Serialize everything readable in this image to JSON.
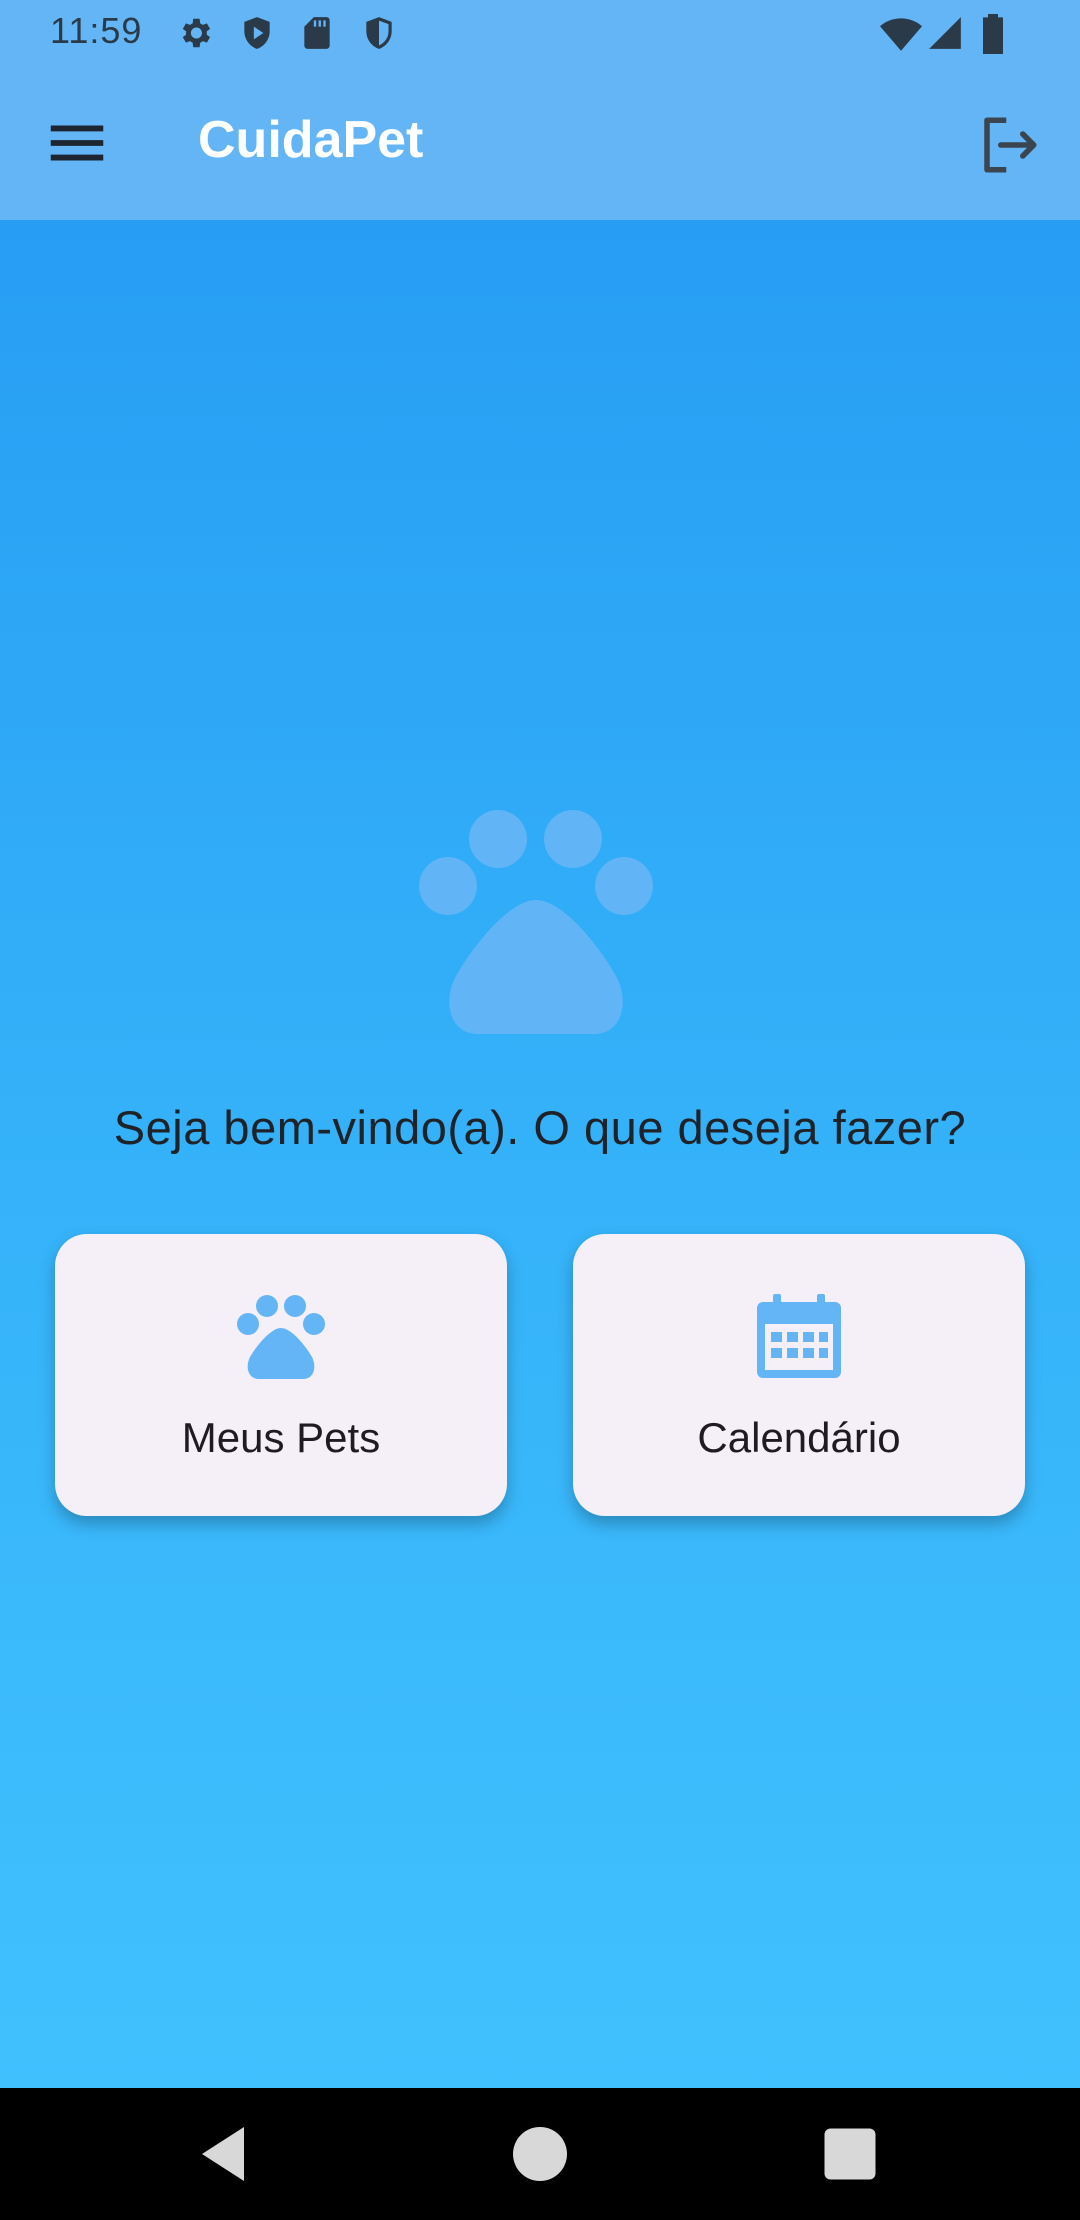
{
  "status_bar": {
    "time": "11:59",
    "icons": [
      "gear-icon",
      "play-shield-icon",
      "sd-card-icon",
      "shield-icon",
      "wifi-icon",
      "signal-icon",
      "battery-icon"
    ]
  },
  "app_bar": {
    "title": "CuidaPet",
    "menu_icon": "menu-icon",
    "logout_icon": "logout-icon"
  },
  "main": {
    "hero_icon": "paw-icon",
    "welcome_text": "Seja bem-vindo(a). O que deseja fazer?",
    "cards": [
      {
        "label": "Meus Pets",
        "icon": "paw-icon"
      },
      {
        "label": "Calendário",
        "icon": "calendar-icon"
      }
    ]
  },
  "nav_bar": {
    "buttons": [
      "back-icon",
      "home-icon",
      "recents-icon"
    ]
  },
  "colors": {
    "app_bar": "#64b5f6",
    "gradient_top": "#2499f2",
    "gradient_bottom": "#42c3fe",
    "card_bg": "#f5eff8",
    "icon_accent": "#64b5f6"
  }
}
